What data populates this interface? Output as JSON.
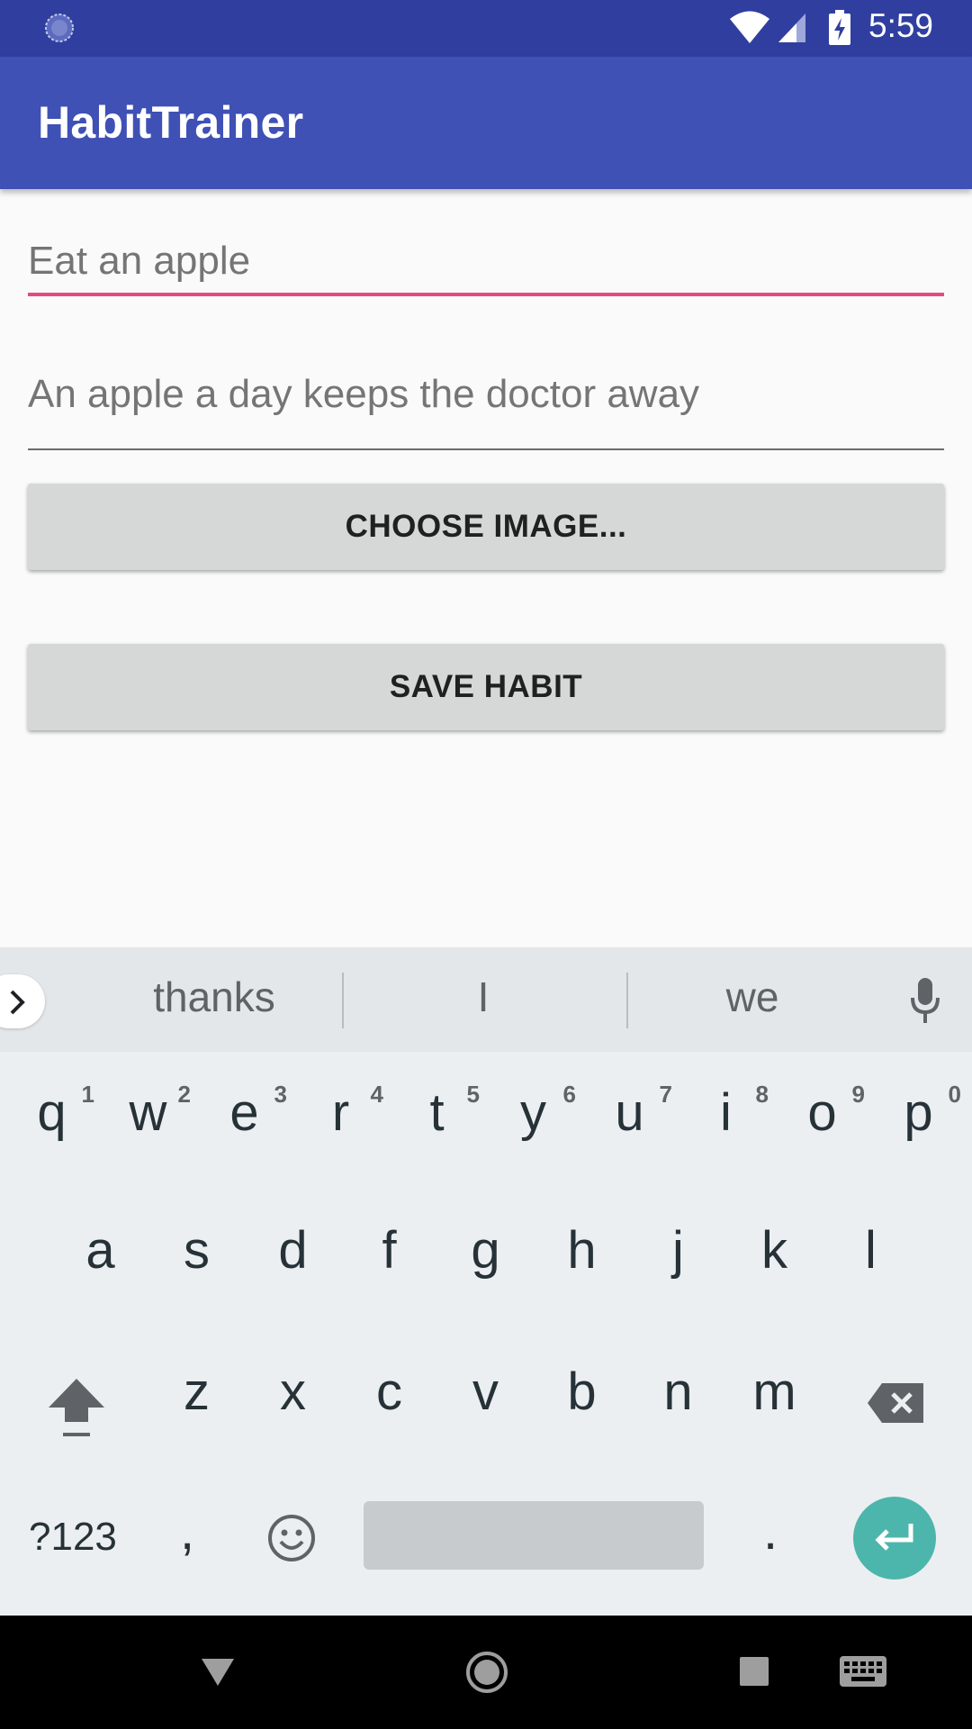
{
  "status_bar": {
    "time": "5:59"
  },
  "app_bar": {
    "title": "HabitTrainer"
  },
  "form": {
    "title_placeholder": "Eat an apple",
    "description_placeholder": "An apple a day keeps the doctor away",
    "choose_image_label": "CHOOSE IMAGE...",
    "save_label": "SAVE HABIT"
  },
  "keyboard": {
    "suggestions": [
      "thanks",
      "I",
      "we"
    ],
    "row1": [
      {
        "k": "q",
        "h": "1"
      },
      {
        "k": "w",
        "h": "2"
      },
      {
        "k": "e",
        "h": "3"
      },
      {
        "k": "r",
        "h": "4"
      },
      {
        "k": "t",
        "h": "5"
      },
      {
        "k": "y",
        "h": "6"
      },
      {
        "k": "u",
        "h": "7"
      },
      {
        "k": "i",
        "h": "8"
      },
      {
        "k": "o",
        "h": "9"
      },
      {
        "k": "p",
        "h": "0"
      }
    ],
    "row2": [
      "a",
      "s",
      "d",
      "f",
      "g",
      "h",
      "j",
      "k",
      "l"
    ],
    "row3": [
      "z",
      "x",
      "c",
      "v",
      "b",
      "n",
      "m"
    ],
    "symbols_label": "?123",
    "comma": ",",
    "period": "."
  },
  "colors": {
    "status_bar": "#303f9f",
    "app_bar": "#3f51b5",
    "accent": "#e84a7f",
    "enter_key": "#4db6ac"
  }
}
